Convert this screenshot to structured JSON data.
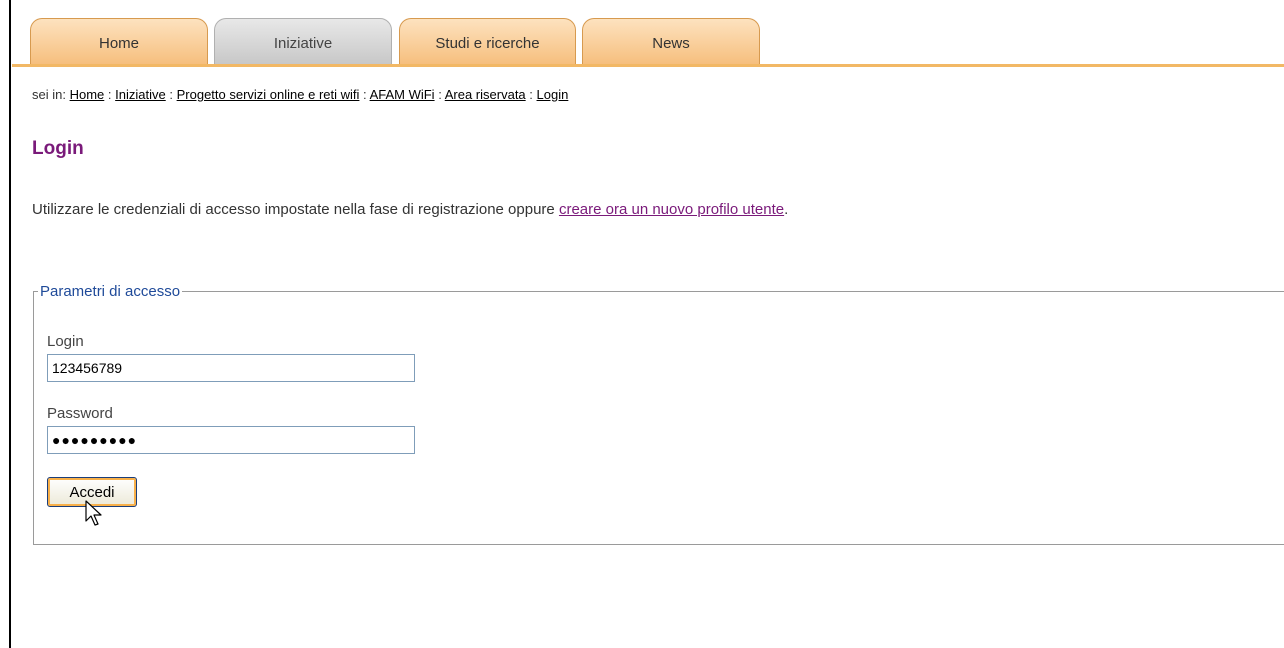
{
  "tabs": [
    {
      "label": "Home",
      "active": false
    },
    {
      "label": "Iniziative",
      "active": true
    },
    {
      "label": "Studi e ricerche",
      "active": false
    },
    {
      "label": "News",
      "active": false
    }
  ],
  "breadcrumb": {
    "prefix": "sei in:",
    "separator": ":",
    "items": [
      "Home",
      "Iniziative",
      "Progetto servizi online e reti wifi",
      "AFAM WiFi",
      "Area riservata",
      "Login"
    ]
  },
  "page": {
    "title": "Login",
    "intro_text": "Utilizzare le credenziali di accesso impostate nella fase di registrazione oppure",
    "intro_link": "creare ora un nuovo profilo utente",
    "intro_end": "."
  },
  "form": {
    "legend": "Parametri di accesso",
    "login_label": "Login",
    "login_value": "123456789",
    "password_label": "Password",
    "password_value": "●●●●●●●●●",
    "submit_label": "Accedi"
  },
  "colors": {
    "tab_orange": "#f6bf7e",
    "tab_active_gray": "#c8c8c8",
    "title_purple": "#7a1a7a",
    "legend_blue": "#1f4a99"
  }
}
